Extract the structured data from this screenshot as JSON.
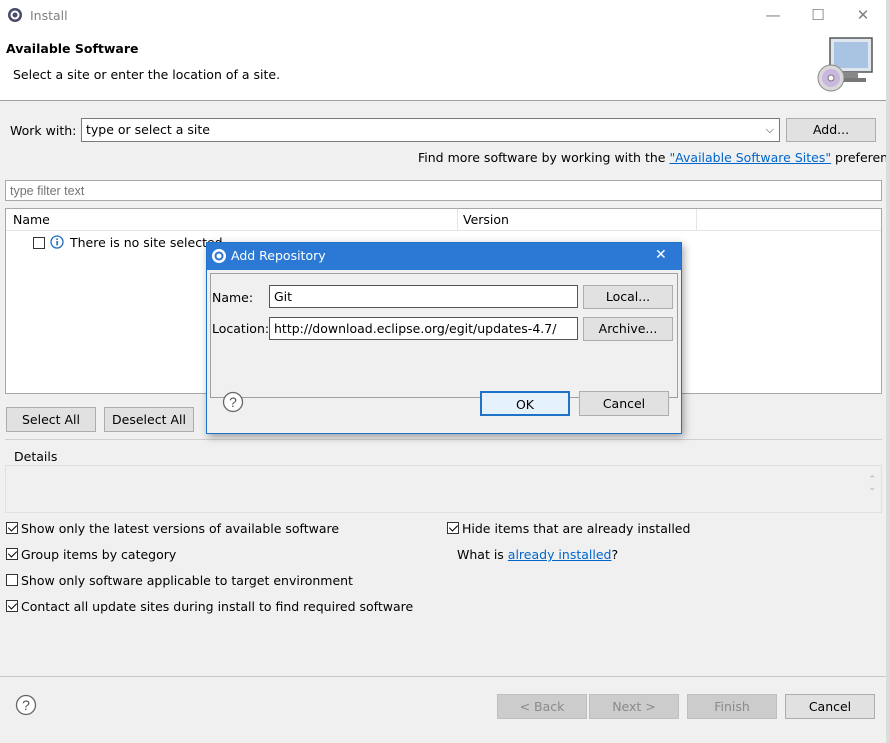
{
  "window": {
    "title": "Install",
    "minimize": "—",
    "maximize": "☐",
    "close": "✕"
  },
  "header": {
    "heading": "Available Software",
    "subtitle": "Select a site or enter the location of a site."
  },
  "work_with": {
    "label": "Work with:",
    "value": "type or select a site",
    "add_button": "Add...",
    "find_more_prefix": "Find more software by working with the ",
    "find_more_link": "\"Available Software Sites\"",
    "find_more_suffix": " preferences."
  },
  "filter": {
    "placeholder": "type filter text"
  },
  "table": {
    "columns": [
      "Name",
      "Version"
    ],
    "empty_row": "There is no site selected."
  },
  "selection_buttons": {
    "select_all": "Select All",
    "deselect_all": "Deselect All"
  },
  "details": {
    "label": "Details"
  },
  "options": {
    "latest_versions": {
      "label": "Show only the latest versions of available software",
      "checked": true
    },
    "group_by_category": {
      "label": "Group items by category",
      "checked": true
    },
    "target_env": {
      "label": "Show only software applicable to target environment",
      "checked": false
    },
    "contact_sites": {
      "label": "Contact all update sites during install to find required software",
      "checked": true
    },
    "hide_installed": {
      "label": "Hide items that are already installed",
      "checked": true
    },
    "what_is_prefix": "What is ",
    "what_is_link": "already installed",
    "what_is_suffix": "?"
  },
  "footer": {
    "back": "< Back",
    "next": "Next >",
    "finish": "Finish",
    "cancel": "Cancel"
  },
  "dialog": {
    "title": "Add Repository",
    "close": "✕",
    "name_label": "Name:",
    "name_value": "Git",
    "location_label": "Location:",
    "location_value": "http://download.eclipse.org/egit/updates-4.7/",
    "local_button": "Local...",
    "archive_button": "Archive...",
    "ok_button": "OK",
    "cancel_button": "Cancel"
  },
  "colors": {
    "accent": "#2b79d4",
    "link": "#0066cc",
    "background": "#f0f0f0"
  }
}
